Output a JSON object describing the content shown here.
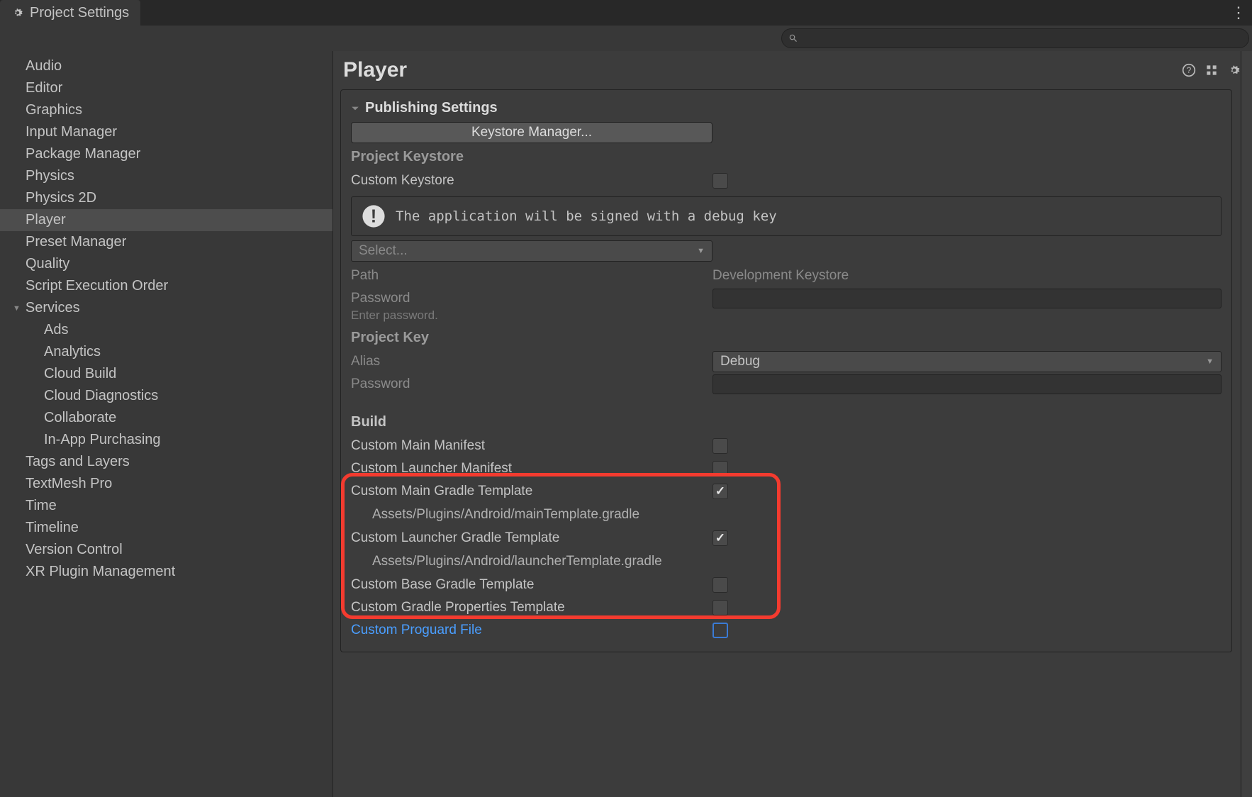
{
  "tab": {
    "title": "Project Settings"
  },
  "search": {
    "placeholder": ""
  },
  "sidebar": {
    "items": [
      {
        "label": "Audio"
      },
      {
        "label": "Editor"
      },
      {
        "label": "Graphics"
      },
      {
        "label": "Input Manager"
      },
      {
        "label": "Package Manager"
      },
      {
        "label": "Physics"
      },
      {
        "label": "Physics 2D"
      },
      {
        "label": "Player",
        "selected": true
      },
      {
        "label": "Preset Manager"
      },
      {
        "label": "Quality"
      },
      {
        "label": "Script Execution Order"
      },
      {
        "label": "Services",
        "expandable": true,
        "children": [
          {
            "label": "Ads"
          },
          {
            "label": "Analytics"
          },
          {
            "label": "Cloud Build"
          },
          {
            "label": "Cloud Diagnostics"
          },
          {
            "label": "Collaborate"
          },
          {
            "label": "In-App Purchasing"
          }
        ]
      },
      {
        "label": "Tags and Layers"
      },
      {
        "label": "TextMesh Pro"
      },
      {
        "label": "Time"
      },
      {
        "label": "Timeline"
      },
      {
        "label": "Version Control"
      },
      {
        "label": "XR Plugin Management"
      }
    ]
  },
  "content": {
    "title": "Player",
    "publishing": {
      "section": "Publishing Settings",
      "keystore_manager": "Keystore Manager...",
      "project_keystore": "Project Keystore",
      "custom_keystore": "Custom Keystore",
      "info": "The application will be signed with a debug key",
      "select": "Select...",
      "path_label": "Path",
      "path_value": "Development Keystore",
      "password_label": "Password",
      "password_hint": "Enter password.",
      "project_key": "Project Key",
      "alias_label": "Alias",
      "alias_value": "Debug",
      "key_password_label": "Password",
      "build": "Build",
      "custom_main_manifest": "Custom Main Manifest",
      "custom_launcher_manifest": "Custom Launcher Manifest",
      "custom_main_gradle": "Custom Main Gradle Template",
      "main_gradle_path": "Assets/Plugins/Android/mainTemplate.gradle",
      "custom_launcher_gradle": "Custom Launcher Gradle Template",
      "launcher_gradle_path": "Assets/Plugins/Android/launcherTemplate.gradle",
      "custom_base_gradle": "Custom Base Gradle Template",
      "custom_gradle_props": "Custom Gradle Properties Template",
      "custom_proguard": "Custom Proguard File"
    }
  }
}
